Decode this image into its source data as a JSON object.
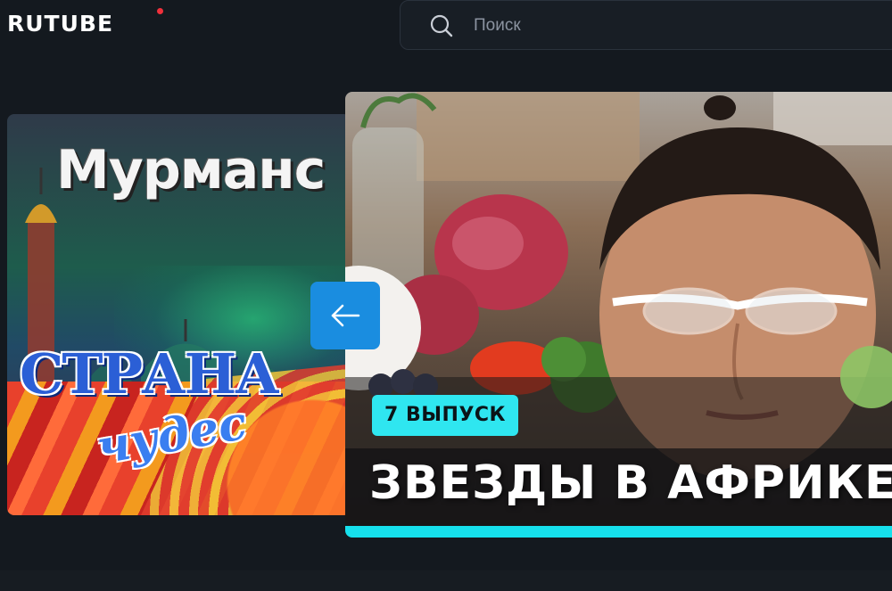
{
  "header": {
    "logo_text": "RUTUBE",
    "logo_dot_color": "#f0303b",
    "search": {
      "placeholder": "Поиск",
      "icon": "search-icon"
    }
  },
  "carousel": {
    "prev_icon": "arrow-left-icon",
    "accent_color": "#16e0ec",
    "items": [
      {
        "thumbnail_text_top": "Мурманс",
        "thumbnail_logo_line1": "СТРАНА",
        "thumbnail_logo_line2": "чудес"
      },
      {
        "episode_badge": "7 ВЫПУСК",
        "title": "ЗВЕЗДЫ В АФРИКЕ"
      }
    ]
  }
}
